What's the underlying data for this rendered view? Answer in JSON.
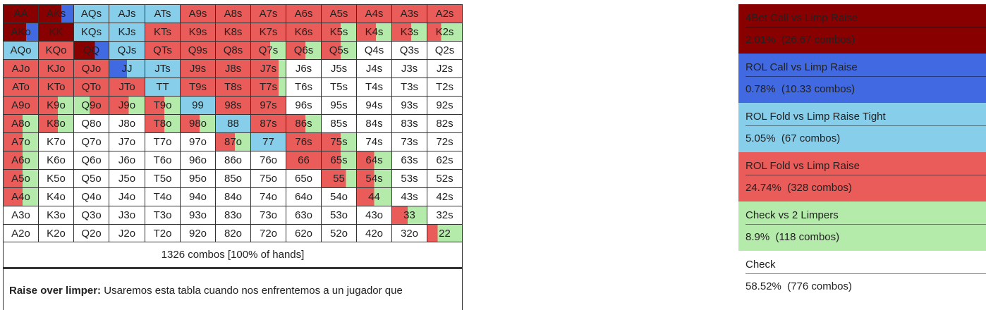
{
  "colors": {
    "4bet_call": "#880000",
    "rol_call": "#4169e1",
    "rol_fold_tight": "#87ceeb",
    "rol_fold": "#ea5c59",
    "check_2": "#b4ebaa",
    "check": "#ffffff",
    "grid_line": "#333333"
  },
  "grid": {
    "rows": [
      [
        "AA",
        "AKs",
        "AQs",
        "AJs",
        "ATs",
        "A9s",
        "A8s",
        "A7s",
        "A6s",
        "A5s",
        "A4s",
        "A3s",
        "A2s"
      ],
      [
        "AKo",
        "KK",
        "KQs",
        "KJs",
        "KTs",
        "K9s",
        "K8s",
        "K7s",
        "K6s",
        "K5s",
        "K4s",
        "K3s",
        "K2s"
      ],
      [
        "AQo",
        "KQo",
        "QQ",
        "QJs",
        "QTs",
        "Q9s",
        "Q8s",
        "Q7s",
        "Q6s",
        "Q5s",
        "Q4s",
        "Q3s",
        "Q2s"
      ],
      [
        "AJo",
        "KJo",
        "QJo",
        "JJ",
        "JTs",
        "J9s",
        "J8s",
        "J7s",
        "J6s",
        "J5s",
        "J4s",
        "J3s",
        "J2s"
      ],
      [
        "ATo",
        "KTo",
        "QTo",
        "JTo",
        "TT",
        "T9s",
        "T8s",
        "T7s",
        "T6s",
        "T5s",
        "T4s",
        "T3s",
        "T2s"
      ],
      [
        "A9o",
        "K9o",
        "Q9o",
        "J9o",
        "T9o",
        "99",
        "98s",
        "97s",
        "96s",
        "95s",
        "94s",
        "93s",
        "92s"
      ],
      [
        "A8o",
        "K8o",
        "Q8o",
        "J8o",
        "T8o",
        "98o",
        "88",
        "87s",
        "86s",
        "85s",
        "84s",
        "83s",
        "82s"
      ],
      [
        "A7o",
        "K7o",
        "Q7o",
        "J7o",
        "T7o",
        "97o",
        "87o",
        "77",
        "76s",
        "75s",
        "74s",
        "73s",
        "72s"
      ],
      [
        "A6o",
        "K6o",
        "Q6o",
        "J6o",
        "T6o",
        "96o",
        "86o",
        "76o",
        "66",
        "65s",
        "64s",
        "63s",
        "62s"
      ],
      [
        "A5o",
        "K5o",
        "Q5o",
        "J5o",
        "T5o",
        "95o",
        "85o",
        "75o",
        "65o",
        "55",
        "54s",
        "53s",
        "52s"
      ],
      [
        "A4o",
        "K4o",
        "Q4o",
        "J4o",
        "T4o",
        "94o",
        "84o",
        "74o",
        "64o",
        "54o",
        "44",
        "43s",
        "42s"
      ],
      [
        "A3o",
        "K3o",
        "Q3o",
        "J3o",
        "T3o",
        "93o",
        "83o",
        "73o",
        "63o",
        "53o",
        "43o",
        "33",
        "32s"
      ],
      [
        "A2o",
        "K2o",
        "Q2o",
        "J2o",
        "T2o",
        "92o",
        "82o",
        "72o",
        "62o",
        "52o",
        "42o",
        "32o",
        "22"
      ]
    ],
    "mix": {
      "AA": [
        [
          "4bet_call",
          1
        ]
      ],
      "AKs": [
        [
          "4bet_call",
          0.65
        ],
        [
          "rol_call",
          0.35
        ]
      ],
      "AQs": [
        [
          "rol_fold_tight",
          1
        ]
      ],
      "AJs": [
        [
          "rol_fold_tight",
          1
        ]
      ],
      "ATs": [
        [
          "rol_fold_tight",
          1
        ]
      ],
      "A9s": [
        [
          "rol_fold",
          1
        ]
      ],
      "A8s": [
        [
          "rol_fold",
          1
        ]
      ],
      "A7s": [
        [
          "rol_fold",
          1
        ]
      ],
      "A6s": [
        [
          "rol_fold",
          1
        ]
      ],
      "A5s": [
        [
          "rol_fold",
          1
        ]
      ],
      "A4s": [
        [
          "rol_fold",
          1
        ]
      ],
      "A3s": [
        [
          "rol_fold",
          1
        ]
      ],
      "A2s": [
        [
          "rol_fold",
          1
        ]
      ],
      "AKo": [
        [
          "4bet_call",
          0.65
        ],
        [
          "rol_call",
          0.35
        ]
      ],
      "KK": [
        [
          "4bet_call",
          1
        ]
      ],
      "KQs": [
        [
          "rol_fold_tight",
          1
        ]
      ],
      "KJs": [
        [
          "rol_fold_tight",
          1
        ]
      ],
      "KTs": [
        [
          "rol_fold",
          1
        ]
      ],
      "K9s": [
        [
          "rol_fold",
          1
        ]
      ],
      "K8s": [
        [
          "rol_fold",
          1
        ]
      ],
      "K7s": [
        [
          "rol_fold",
          1
        ]
      ],
      "K6s": [
        [
          "rol_fold",
          1
        ]
      ],
      "K5s": [
        [
          "rol_fold",
          0.55
        ],
        [
          "check_2",
          0.45
        ]
      ],
      "K4s": [
        [
          "rol_fold",
          0.55
        ],
        [
          "check_2",
          0.45
        ]
      ],
      "K3s": [
        [
          "rol_fold",
          0.55
        ],
        [
          "check_2",
          0.45
        ]
      ],
      "K2s": [
        [
          "rol_fold",
          0.4
        ],
        [
          "check_2",
          0.6
        ]
      ],
      "AQo": [
        [
          "rol_fold_tight",
          1
        ]
      ],
      "KQo": [
        [
          "rol_fold",
          1
        ]
      ],
      "QQ": [
        [
          "4bet_call",
          0.6
        ],
        [
          "rol_call",
          0.4
        ]
      ],
      "QJs": [
        [
          "rol_fold_tight",
          1
        ]
      ],
      "QTs": [
        [
          "rol_fold",
          1
        ]
      ],
      "Q9s": [
        [
          "rol_fold",
          1
        ]
      ],
      "Q8s": [
        [
          "rol_fold",
          1
        ]
      ],
      "Q7s": [
        [
          "rol_fold",
          0.55
        ],
        [
          "check_2",
          0.45
        ]
      ],
      "Q6s": [
        [
          "rol_fold",
          0.55
        ],
        [
          "check_2",
          0.45
        ]
      ],
      "Q5s": [
        [
          "rol_fold",
          0.55
        ],
        [
          "check_2",
          0.45
        ]
      ],
      "AJo": [
        [
          "rol_fold",
          1
        ]
      ],
      "KJo": [
        [
          "rol_fold",
          1
        ]
      ],
      "QJo": [
        [
          "rol_fold",
          1
        ]
      ],
      "JJ": [
        [
          "rol_call",
          0.5
        ],
        [
          "rol_fold_tight",
          0.5
        ]
      ],
      "JTs": [
        [
          "rol_fold_tight",
          1
        ]
      ],
      "J9s": [
        [
          "rol_fold",
          1
        ]
      ],
      "J8s": [
        [
          "rol_fold",
          1
        ]
      ],
      "J7s": [
        [
          "rol_fold",
          0.8
        ],
        [
          "check_2",
          0.2
        ]
      ],
      "ATo": [
        [
          "rol_fold",
          1
        ]
      ],
      "KTo": [
        [
          "rol_fold",
          1
        ]
      ],
      "QTo": [
        [
          "rol_fold",
          1
        ]
      ],
      "JTo": [
        [
          "rol_fold",
          1
        ]
      ],
      "TT": [
        [
          "rol_fold_tight",
          1
        ]
      ],
      "T9s": [
        [
          "rol_fold",
          1
        ]
      ],
      "T8s": [
        [
          "rol_fold",
          1
        ]
      ],
      "T7s": [
        [
          "rol_fold",
          0.8
        ],
        [
          "check_2",
          0.2
        ]
      ],
      "A9o": [
        [
          "rol_fold",
          1
        ]
      ],
      "K9o": [
        [
          "rol_fold",
          0.55
        ],
        [
          "check_2",
          0.45
        ]
      ],
      "Q9o": [
        [
          "check_2",
          0.45
        ],
        [
          "rol_fold",
          0.55
        ]
      ],
      "J9o": [
        [
          "rol_fold",
          0.55
        ],
        [
          "check_2",
          0.45
        ]
      ],
      "T9o": [
        [
          "rol_fold",
          0.55
        ],
        [
          "check_2",
          0.45
        ]
      ],
      "99": [
        [
          "rol_fold_tight",
          1
        ]
      ],
      "98s": [
        [
          "rol_fold",
          1
        ]
      ],
      "97s": [
        [
          "rol_fold",
          1
        ]
      ],
      "A8o": [
        [
          "rol_fold",
          0.55
        ],
        [
          "check_2",
          0.45
        ]
      ],
      "K8o": [
        [
          "rol_fold",
          0.55
        ],
        [
          "check_2",
          0.45
        ]
      ],
      "T8o": [
        [
          "rol_fold",
          0.55
        ],
        [
          "check_2",
          0.45
        ]
      ],
      "98o": [
        [
          "rol_fold",
          0.55
        ],
        [
          "check_2",
          0.45
        ]
      ],
      "88": [
        [
          "rol_fold_tight",
          1
        ]
      ],
      "87s": [
        [
          "rol_fold",
          1
        ]
      ],
      "86s": [
        [
          "rol_fold",
          0.55
        ],
        [
          "check_2",
          0.45
        ]
      ],
      "A7o": [
        [
          "rol_fold",
          0.55
        ],
        [
          "check_2",
          0.45
        ]
      ],
      "87o": [
        [
          "rol_fold",
          0.55
        ],
        [
          "check_2",
          0.45
        ]
      ],
      "77": [
        [
          "rol_fold_tight",
          1
        ]
      ],
      "76s": [
        [
          "rol_fold",
          1
        ]
      ],
      "75s": [
        [
          "rol_fold",
          0.55
        ],
        [
          "check_2",
          0.45
        ]
      ],
      "A6o": [
        [
          "rol_fold",
          0.55
        ],
        [
          "check_2",
          0.45
        ]
      ],
      "66": [
        [
          "rol_fold",
          1
        ]
      ],
      "65s": [
        [
          "rol_fold",
          0.55
        ],
        [
          "check_2",
          0.45
        ]
      ],
      "64s": [
        [
          "rol_fold",
          0.5
        ],
        [
          "check_2",
          0.5
        ]
      ],
      "A5o": [
        [
          "rol_fold",
          0.55
        ],
        [
          "check_2",
          0.45
        ]
      ],
      "55": [
        [
          "rol_fold",
          0.7
        ],
        [
          "check_2",
          0.3
        ]
      ],
      "54s": [
        [
          "rol_fold",
          0.5
        ],
        [
          "check_2",
          0.5
        ]
      ],
      "A4o": [
        [
          "rol_fold",
          0.55
        ],
        [
          "check_2",
          0.45
        ]
      ],
      "44": [
        [
          "rol_fold",
          0.5
        ],
        [
          "check_2",
          0.5
        ]
      ],
      "33": [
        [
          "rol_fold",
          0.45
        ],
        [
          "check_2",
          0.55
        ]
      ],
      "22": [
        [
          "rol_fold",
          0.3
        ],
        [
          "check_2",
          0.7
        ]
      ]
    }
  },
  "summary": "1326 combos [100% of hands]",
  "description": {
    "bold": "Raise over limper:",
    "text": " Usaremos esta tabla cuando nos enfrentemos a un jugador que"
  },
  "legend": [
    {
      "key": "4bet_call",
      "name": "4Bet Call vs Limp Raise",
      "stat": "2.01%  (26.67 combos)"
    },
    {
      "key": "rol_call",
      "name": "ROL Call vs Limp Raise",
      "stat": "0.78%  (10.33 combos)"
    },
    {
      "key": "rol_fold_tight",
      "name": "ROL Fold vs Limp Raise Tight",
      "stat": "5.05%  (67 combos)"
    },
    {
      "key": "rol_fold",
      "name": "ROL Fold vs Limp Raise",
      "stat": "24.74%  (328 combos)"
    },
    {
      "key": "check_2",
      "name": "Check vs 2 Limpers",
      "stat": "8.9%  (118 combos)"
    },
    {
      "key": "check",
      "name": "Check",
      "stat": "58.52%  (776 combos)"
    }
  ]
}
